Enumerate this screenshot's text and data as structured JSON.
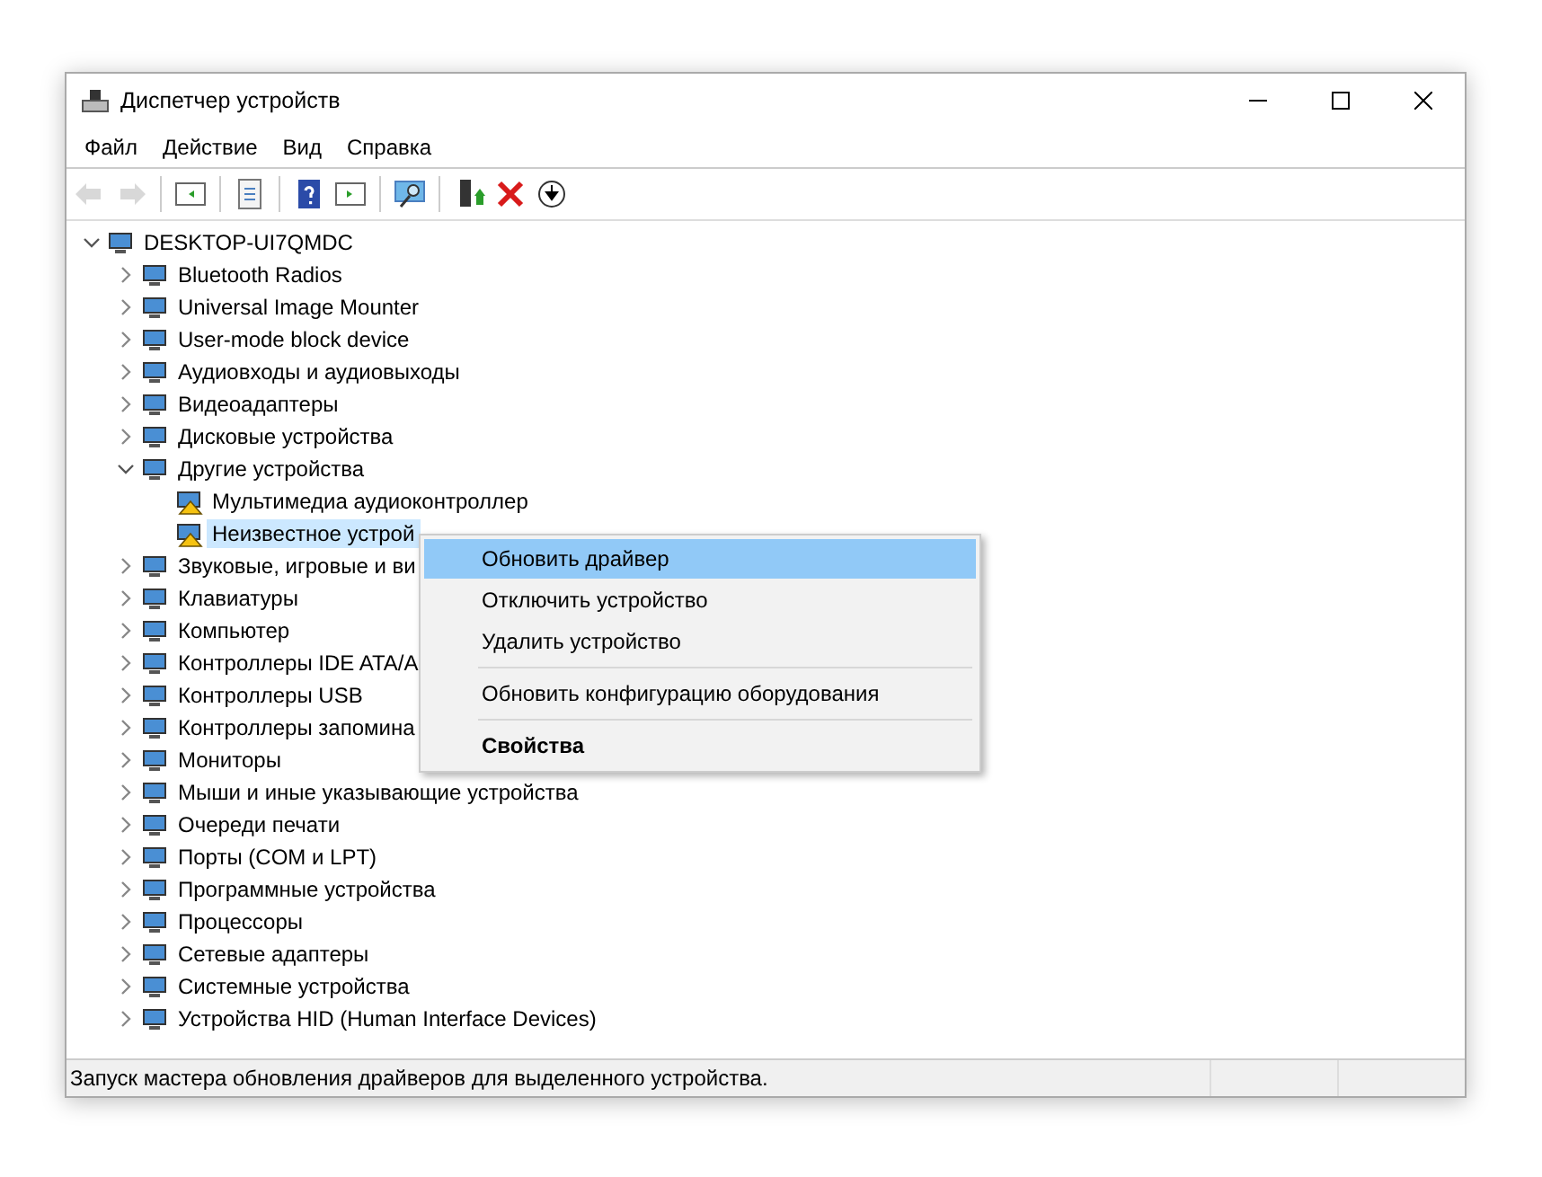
{
  "window": {
    "title": "Диспетчер устройств"
  },
  "menu": [
    "Файл",
    "Действие",
    "Вид",
    "Справка"
  ],
  "toolbar": [
    {
      "kind": "back",
      "disabled": true
    },
    {
      "kind": "forward",
      "disabled": true
    },
    {
      "kind": "separator"
    },
    {
      "kind": "tree-view",
      "disabled": false
    },
    {
      "kind": "separator"
    },
    {
      "kind": "properties",
      "disabled": false
    },
    {
      "kind": "separator"
    },
    {
      "kind": "help",
      "disabled": false
    },
    {
      "kind": "panel",
      "disabled": false
    },
    {
      "kind": "separator"
    },
    {
      "kind": "scan",
      "disabled": false
    },
    {
      "kind": "separator"
    },
    {
      "kind": "update",
      "disabled": false
    },
    {
      "kind": "remove",
      "disabled": false
    },
    {
      "kind": "download",
      "disabled": false
    }
  ],
  "tree": {
    "label": "DESKTOP-UI7QMDC",
    "expanded": true,
    "children": [
      {
        "label": "Bluetooth Radios",
        "expanded": false
      },
      {
        "label": "Universal Image Mounter",
        "expanded": false
      },
      {
        "label": "User-mode block device",
        "expanded": false
      },
      {
        "label": "Аудиовходы и аудиовыходы",
        "expanded": false
      },
      {
        "label": "Видеоадаптеры",
        "expanded": false
      },
      {
        "label": "Дисковые устройства",
        "expanded": false
      },
      {
        "label": "Другие устройства",
        "expanded": true,
        "children": [
          {
            "label": "Мультимедиа аудиоконтроллер",
            "warning": true,
            "selected": false
          },
          {
            "label": "Неизвестное устрой",
            "warning": true,
            "selected": true
          }
        ]
      },
      {
        "label": "Звуковые, игровые и ви",
        "expanded": false
      },
      {
        "label": "Клавиатуры",
        "expanded": false
      },
      {
        "label": "Компьютер",
        "expanded": false
      },
      {
        "label": "Контроллеры IDE ATA/A",
        "expanded": false
      },
      {
        "label": "Контроллеры USB",
        "expanded": false
      },
      {
        "label": "Контроллеры запомина",
        "expanded": false
      },
      {
        "label": "Мониторы",
        "expanded": false
      },
      {
        "label": "Мыши и иные указывающие устройства",
        "expanded": false
      },
      {
        "label": "Очереди печати",
        "expanded": false
      },
      {
        "label": "Порты (COM и LPT)",
        "expanded": false
      },
      {
        "label": "Программные устройства",
        "expanded": false
      },
      {
        "label": "Процессоры",
        "expanded": false
      },
      {
        "label": "Сетевые адаптеры",
        "expanded": false
      },
      {
        "label": "Системные устройства",
        "expanded": false
      },
      {
        "label": "Устройства HID (Human Interface Devices)",
        "expanded": false
      }
    ]
  },
  "context_menu": [
    {
      "label": "Обновить драйвер",
      "selected": true,
      "default": false,
      "separator_before": false
    },
    {
      "label": "Отключить устройство",
      "selected": false,
      "default": false,
      "separator_before": false
    },
    {
      "label": "Удалить устройство",
      "selected": false,
      "default": false,
      "separator_before": false
    },
    {
      "label": "Обновить конфигурацию оборудования",
      "selected": false,
      "default": false,
      "separator_before": true
    },
    {
      "label": "Свойства",
      "selected": false,
      "default": true,
      "separator_before": true
    }
  ],
  "status_bar": {
    "text": "Запуск мастера обновления драйверов для выделенного устройства."
  }
}
